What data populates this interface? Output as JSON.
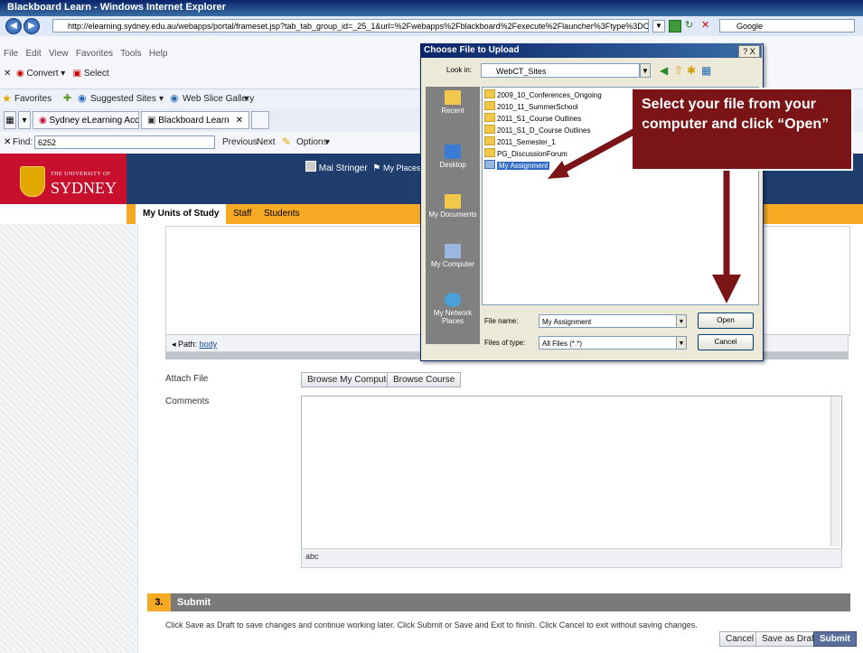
{
  "window": {
    "title": "Blackboard Learn - Windows Internet Explorer"
  },
  "browser": {
    "address": "http://elearning.sydney.edu.au/webapps/portal/frameset.jsp?tab_tab_group_id=_25_1&url=%2Fwebapps%2Fblackboard%2Fexecute%2Flauncher%3Ftype%3DCourse%26id%3D_9340_1%",
    "search_placeholder": "Google",
    "menu": [
      "File",
      "Edit",
      "View",
      "Favorites",
      "Tools",
      "Help"
    ],
    "convert_label": "Convert",
    "select_label": "Select",
    "favorites_label": "Favorites",
    "suggested_sites": "Suggested Sites",
    "web_slice": "Web Slice Gallery",
    "tabs": [
      "Sydney eLearning Account ...",
      "Blackboard Learn"
    ],
    "find_label": "Find:",
    "find_value": "6252",
    "previous": "Previous",
    "next": "Next",
    "options": "Options"
  },
  "page": {
    "uni_small": "THE UNIVERSITY OF",
    "uni_big": "SYDNEY",
    "user_name": "Mai Stringer",
    "my_places": "My Places",
    "nav_tabs": [
      "My Units of Study",
      "Staff",
      "Students"
    ],
    "path_label": "Path:",
    "path_link": "body",
    "attach_label": "Attach File",
    "browse_computer": "Browse My Computer",
    "browse_course": "Browse Course",
    "comments_label": "Comments",
    "spell": "abc",
    "submit_num": "3.",
    "submit_title": "Submit",
    "instruction": "Click Save as Draft to save changes and continue working later. Click Submit or Save and Exit to finish. Click Cancel to exit without saving changes.",
    "cancel": "Cancel",
    "save_draft": "Save as Draft",
    "submit": "Submit"
  },
  "dialog": {
    "title": "Choose File to Upload",
    "help_close": "? X",
    "look_in_label": "Look in:",
    "look_in_value": "WebCT_Sites",
    "places": [
      "Recent",
      "Desktop",
      "My Documents",
      "My Computer",
      "My Network Places"
    ],
    "files": [
      "2009_10_Conferences_Ongoing",
      "2010_11_SummerSchool",
      "2011_S1_Course Outlines",
      "2011_S1_D_Course Outlines",
      "2011_Semester_1",
      "PG_DiscussionForum",
      "My Assignment"
    ],
    "file_name_label": "File name:",
    "file_name_value": "My Assignment",
    "file_type_label": "Files of type:",
    "file_type_value": "All Files (*.*)",
    "open": "Open",
    "cancel": "Cancel"
  },
  "callout": {
    "text": "Select your file from your computer and click “Open”"
  },
  "colors": {
    "callout": "#7b1416",
    "banner_red": "#c8102e",
    "navbar": "#f6a923",
    "dark_blue": "#1f3e6e"
  }
}
